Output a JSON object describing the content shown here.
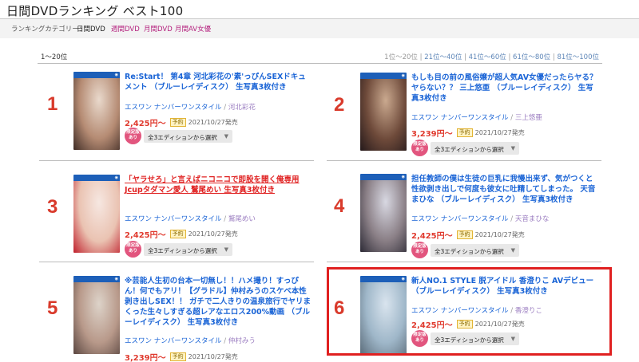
{
  "page": {
    "title": "日間DVDランキング ベスト100"
  },
  "categories": {
    "label": "ランキングカテゴリー：",
    "items": [
      {
        "label": "日間DVD",
        "active": true
      },
      {
        "label": "週間DVD",
        "active": false
      },
      {
        "label": "月間DVD",
        "active": false
      },
      {
        "label": "月間AV女優",
        "active": false
      }
    ]
  },
  "list": {
    "range_label": "1〜20位",
    "pager": [
      {
        "label": "1位〜20位",
        "link": false
      },
      {
        "label": "21位〜40位",
        "link": true
      },
      {
        "label": "41位〜60位",
        "link": true
      },
      {
        "label": "61位〜80位",
        "link": true
      },
      {
        "label": "81位〜100位",
        "link": true
      }
    ]
  },
  "common": {
    "label_sep": "/",
    "pager_sep": "|",
    "reserve_tag": "予約",
    "edition_badge_line1": "限定版",
    "edition_badge_line2": "あり",
    "edition_select": "全3エディションから選択",
    "chevron_icon": "chevron-down-icon"
  },
  "items": [
    {
      "rank": "1",
      "title": "Re:Start！ 第4章 河北彩花の'素'っぴんSEXドキュメント （ブルーレイディスク） 生写真3枚付き",
      "title_style": "blue",
      "label": "エスワン ナンバーワンスタイル",
      "actress": "河北彩花",
      "price": "2,425円〜",
      "release": "2021/10/27発売",
      "cover_colors": [
        "#e9d9cc",
        "#b58b73",
        "#3e2b25"
      ]
    },
    {
      "rank": "2",
      "title": "もしも目の前の風俗嬢が超人気AV女優だったらヤる？ヤらない？？ 三上悠亜 （ブルーレイディスク） 生写真3枚付き",
      "title_style": "blue",
      "label": "エスワン ナンバーワンスタイル",
      "actress": "三上悠亜",
      "price": "3,239円〜",
      "release": "2021/10/27発売",
      "cover_colors": [
        "#caa98f",
        "#6e4a3a",
        "#23181a"
      ]
    },
    {
      "rank": "3",
      "title": "「ヤラせろ」と言えばニコニコで即股を開く俺専用Jcupタダマン愛人 鷲尾めい 生写真3枚付き",
      "title_style": "red",
      "label": "エスワン ナンバーワンスタイル",
      "actress": "鷲尾めい",
      "price": "2,425円〜",
      "release": "2021/10/27発売",
      "cover_colors": [
        "#f6e7e1",
        "#eac3b2",
        "#c0202c"
      ]
    },
    {
      "rank": "4",
      "title": "担任教師の僕は生徒の巨乳に我慢出来ず、気がつくと性欲剥き出しで何度も彼女に吐精してしまった。 天音まひな （ブルーレイディスク） 生写真3枚付き",
      "title_style": "blue",
      "label": "エスワン ナンバーワンスタイル",
      "actress": "天音まひな",
      "price": "2,425円〜",
      "release": "2021/10/27発売",
      "cover_colors": [
        "#d8d8e2",
        "#8a7f86",
        "#2c2a35"
      ]
    },
    {
      "rank": "5",
      "title": "※芸能人生初の台本一切無し！！ハメ撮り！すっぴん！何でもアリ！【グラドル】仲村みうのスケベ本性剥き出しSEX！！ ガチで二人きりの温泉旅行でヤリまくった生々しすぎる超レアなエロス200%動画 （ブルーレイディスク） 生写真3枚付き",
      "title_style": "blue",
      "label": "エスワン ナンバーワンスタイル",
      "actress": "仲村みう",
      "price": "3,239円〜",
      "release": "2021/10/27発売",
      "cover_colors": [
        "#ddd3c9",
        "#b8998a",
        "#5a4640"
      ]
    },
    {
      "rank": "6",
      "title": "新人NO.1 STYLE 脱アイドル 香澄りこ AVデビュー （ブルーレイディスク） 生写真3枚付き",
      "title_style": "blue",
      "label": "エスワン ナンバーワンスタイル",
      "actress": "香澄りこ",
      "price": "2,425円〜",
      "release": "2021/10/27発売",
      "cover_colors": [
        "#d9e4ee",
        "#9fb7c9",
        "#5b6c7a"
      ]
    }
  ]
}
